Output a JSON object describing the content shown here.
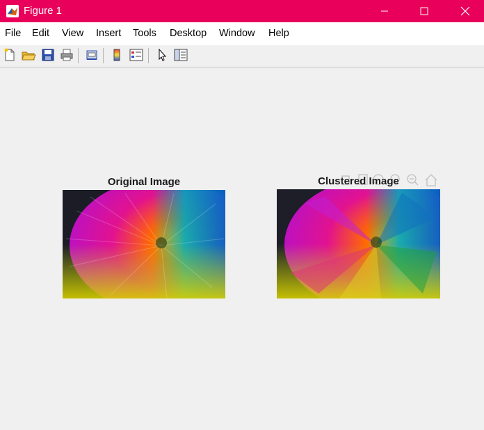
{
  "window": {
    "title": "Figure 1"
  },
  "menu": [
    "File",
    "Edit",
    "View",
    "Insert",
    "Tools",
    "Desktop",
    "Window",
    "Help"
  ],
  "toolbar": {
    "buttons": [
      "new-figure-icon",
      "open-icon",
      "save-icon",
      "print-icon",
      "print-preview-icon",
      "colorbar-icon",
      "legend-icon",
      "pointer-icon",
      "property-inspector-icon"
    ]
  },
  "axes": [
    {
      "title": "Original Image"
    },
    {
      "title": "Clustered Image"
    }
  ],
  "axes_toolbar": {
    "icons": [
      "data-cursor-icon",
      "brush-icon",
      "pan-icon",
      "zoom-in-icon",
      "zoom-out-icon",
      "home-icon"
    ]
  }
}
